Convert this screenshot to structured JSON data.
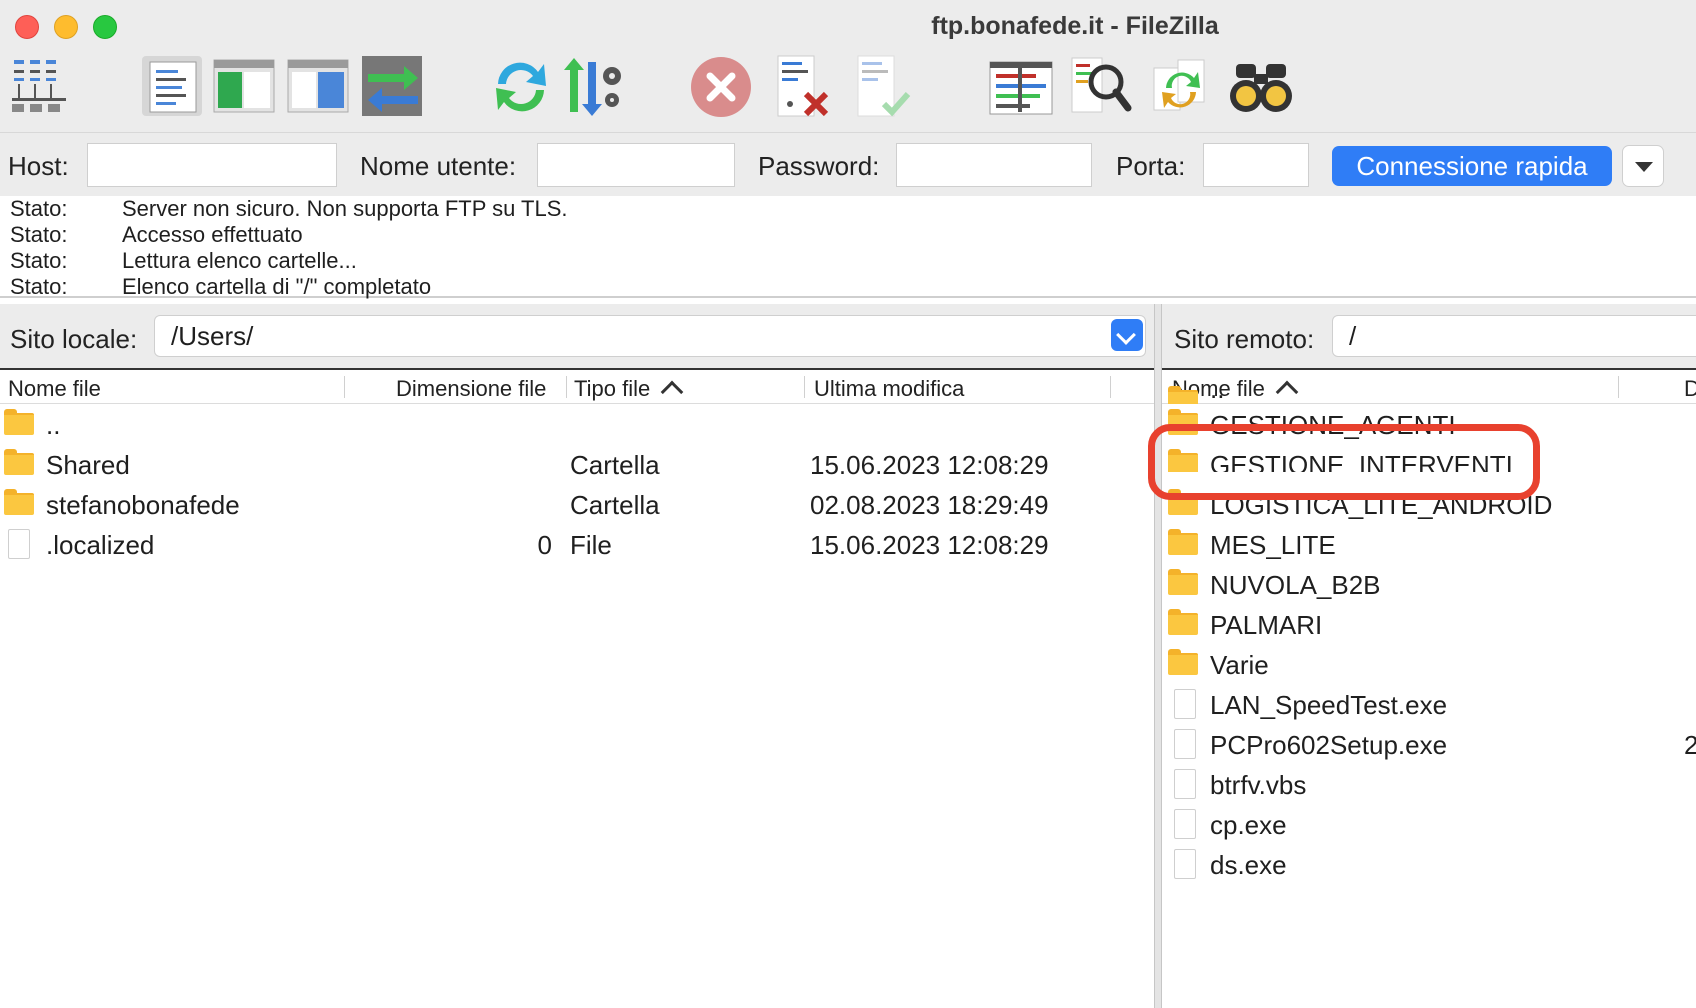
{
  "window": {
    "title": "ftp.bonafede.it - FileZilla",
    "controls": [
      "close",
      "minimize",
      "maximize"
    ]
  },
  "toolbar": {
    "buttons": [
      {
        "icon": "site-manager-icon"
      },
      {
        "icon": "toggle-message-log-icon"
      },
      {
        "icon": "toggle-local-tree-icon"
      },
      {
        "icon": "toggle-remote-tree-icon"
      },
      {
        "icon": "transfer-queue-icon"
      },
      {
        "icon": "refresh-icon"
      },
      {
        "icon": "filter-settings-icon"
      },
      {
        "icon": "cancel-operation-icon"
      },
      {
        "icon": "disconnect-icon"
      },
      {
        "icon": "reconnect-icon"
      },
      {
        "icon": "directory-listing-filters-icon"
      },
      {
        "icon": "compare-directories-icon"
      },
      {
        "icon": "synchronized-browsing-icon"
      },
      {
        "icon": "search-remote-files-icon"
      }
    ]
  },
  "quickconnect": {
    "host_label": "Host:",
    "host_value": "",
    "user_label": "Nome utente:",
    "user_value": "",
    "password_label": "Password:",
    "password_value": "",
    "port_label": "Porta:",
    "port_value": "",
    "button_label": "Connessione rapida"
  },
  "log": [
    {
      "key": "Stato:",
      "message": "Server non sicuro. Non supporta FTP su TLS."
    },
    {
      "key": "Stato:",
      "message": "Accesso effettuato"
    },
    {
      "key": "Stato:",
      "message": "Lettura elenco cartelle..."
    },
    {
      "key": "Stato:",
      "message": "Elenco cartella di \"/\" completato"
    }
  ],
  "local": {
    "site_label": "Sito locale:",
    "path": "/Users/",
    "columns": {
      "name": "Nome file",
      "size": "Dimensione file",
      "type": "Tipo file",
      "modified": "Ultima modifica"
    },
    "rows": [
      {
        "name": "..",
        "size": "",
        "type": "",
        "modified": "",
        "kind": "folder"
      },
      {
        "name": "Shared",
        "size": "",
        "type": "Cartella",
        "modified": "15.06.2023 12:08:29",
        "kind": "folder"
      },
      {
        "name": "stefanobonafede",
        "size": "",
        "type": "Cartella",
        "modified": "02.08.2023 18:29:49",
        "kind": "folder"
      },
      {
        "name": ".localized",
        "size": "0",
        "type": "File",
        "modified": "15.06.2023 12:08:29",
        "kind": "file"
      }
    ]
  },
  "remote": {
    "site_label": "Sito remoto:",
    "path": "/",
    "columns": {
      "name": "Nome file",
      "size_partial": "D"
    },
    "rows": [
      {
        "name": "..",
        "size_partial": "",
        "kind": "folder"
      },
      {
        "name": "GESTIONE_AGENTI",
        "size_partial": "",
        "kind": "folder"
      },
      {
        "name": "GESTIONE_INTERVENTI",
        "size_partial": "",
        "kind": "folder"
      },
      {
        "name": "LOGISTICA_LITE_ANDROID",
        "size_partial": "",
        "kind": "folder"
      },
      {
        "name": "MES_LITE",
        "size_partial": "",
        "kind": "folder"
      },
      {
        "name": "NUVOLA_B2B",
        "size_partial": "",
        "kind": "folder"
      },
      {
        "name": "PALMARI",
        "size_partial": "",
        "kind": "folder"
      },
      {
        "name": "Varie",
        "size_partial": "",
        "kind": "folder"
      },
      {
        "name": "LAN_SpeedTest.exe",
        "size_partial": "",
        "kind": "file"
      },
      {
        "name": "PCPro602Setup.exe",
        "size_partial": "2",
        "kind": "file"
      },
      {
        "name": "btrfv.vbs",
        "size_partial": "",
        "kind": "file"
      },
      {
        "name": "cp.exe",
        "size_partial": "",
        "kind": "file"
      },
      {
        "name": "ds.exe",
        "size_partial": "",
        "kind": "file"
      }
    ],
    "highlighted_item": "GESTIONE_AGENTI"
  },
  "colors": {
    "accent": "#2f7df6",
    "highlight_ring": "#e8412e",
    "folder": "#fbc740"
  }
}
